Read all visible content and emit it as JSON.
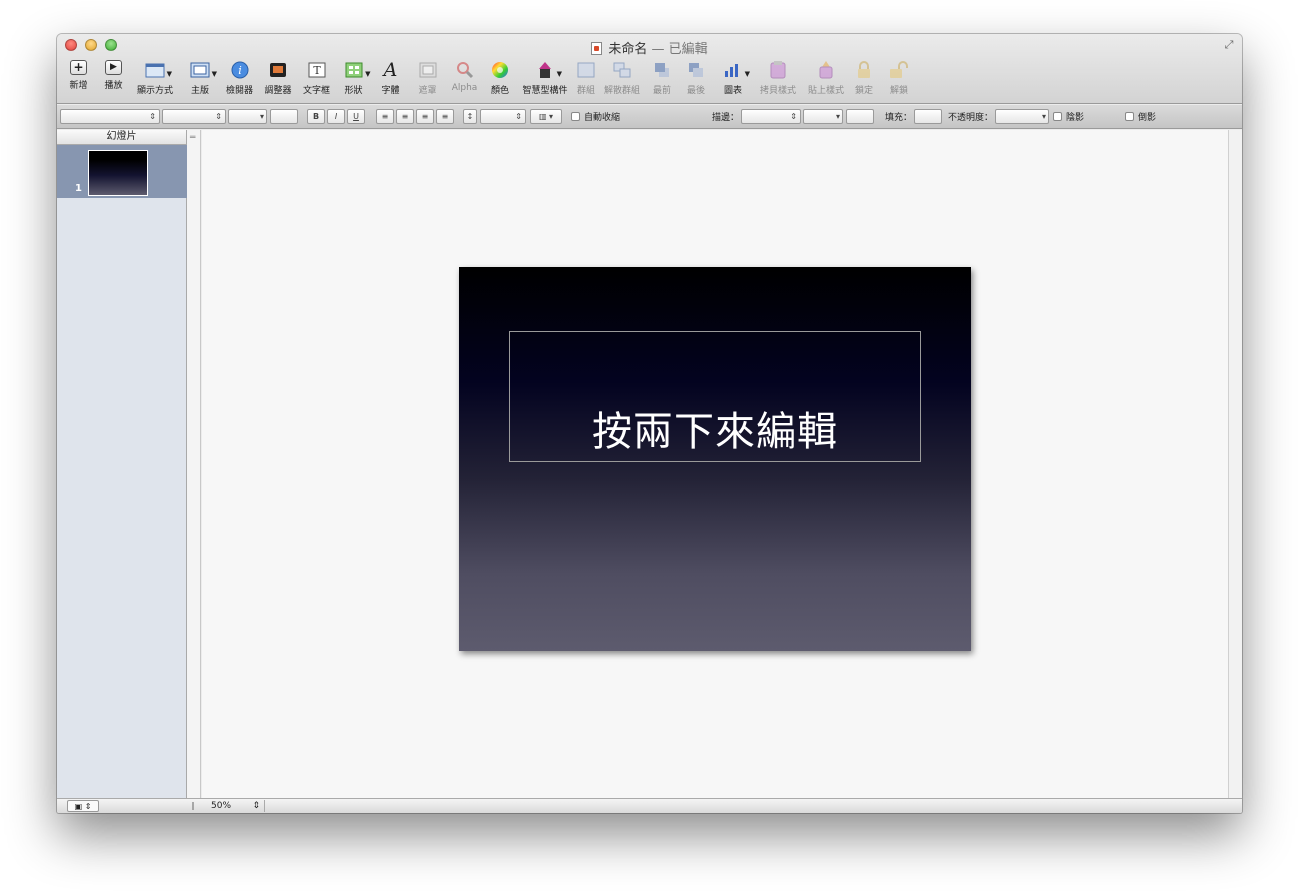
{
  "window": {
    "title": "未命名",
    "title_separator": "—",
    "title_status": "已編輯"
  },
  "toolbar": {
    "items": [
      {
        "label": "新增",
        "icon": "plus-icon"
      },
      {
        "label": "播放",
        "icon": "play-icon"
      },
      {
        "label": "顯示方式",
        "icon": "view-icon"
      },
      {
        "label": "主版",
        "icon": "master-slides-icon"
      },
      {
        "label": "檢閱器",
        "icon": "inspector-icon"
      },
      {
        "label": "調整器",
        "icon": "adjust-image-icon"
      },
      {
        "label": "文字框",
        "icon": "text-box-icon"
      },
      {
        "label": "形狀",
        "icon": "shapes-icon"
      },
      {
        "label": "字體",
        "icon": "fonts-icon"
      },
      {
        "label": "遮罩",
        "icon": "mask-icon"
      },
      {
        "label": "Alpha",
        "icon": "alpha-icon"
      },
      {
        "label": "顏色",
        "icon": "colors-icon"
      },
      {
        "label": "智慧型構件",
        "icon": "smart-build-icon"
      },
      {
        "label": "群組",
        "icon": "group-icon"
      },
      {
        "label": "解散群組",
        "icon": "ungroup-icon"
      },
      {
        "label": "最前",
        "icon": "front-icon"
      },
      {
        "label": "最後",
        "icon": "back-icon"
      },
      {
        "label": "圖表",
        "icon": "chart-icon"
      },
      {
        "label": "拷貝樣式",
        "icon": "copy-style-icon"
      },
      {
        "label": "貼上樣式",
        "icon": "paste-style-icon"
      },
      {
        "label": "鎖定",
        "icon": "lock-icon"
      },
      {
        "label": "解鎖",
        "icon": "unlock-icon"
      }
    ]
  },
  "formatbar": {
    "bold": "B",
    "italic": "I",
    "underline": "U",
    "autoshrink_label": "自動收縮",
    "stroke_label": "描邊：",
    "fill_label": "填充：",
    "opacity_label": "不透明度：",
    "shadow_label": "陰影",
    "reflection_label": "倒影"
  },
  "sidebar": {
    "header": "幻燈片",
    "slides": [
      {
        "number": "1"
      }
    ]
  },
  "slide": {
    "title_placeholder": "按兩下來編輯"
  },
  "statusbar": {
    "zoom": "50%"
  }
}
